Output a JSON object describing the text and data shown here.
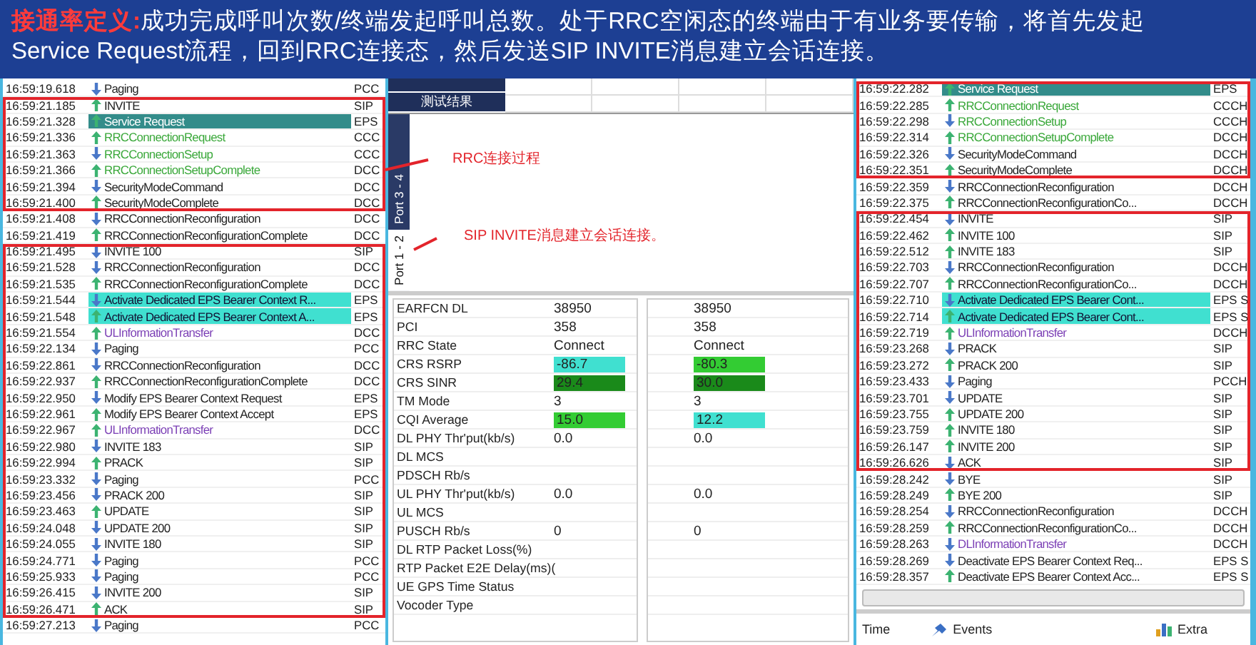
{
  "banner": {
    "label": "接通率定义:",
    "lines": [
      "成功完成呼叫次数/终端发起呼叫总数。处于RRC空闲态的终端由于有业务要传输，将首先发起",
      "Service Request流程，回到RRC连接态，然后发送SIP INVITE消息建立会话连接。"
    ]
  },
  "left_log": {
    "groups": [
      {
        "boxed": false,
        "rows": [
          {
            "time": "16:59:19.618",
            "uplink": false,
            "message": "Paging",
            "channel": "PCC",
            "kind": "plain"
          }
        ]
      },
      {
        "boxed": true,
        "rows": [
          {
            "time": "16:59:21.185",
            "uplink": true,
            "message": "INVITE",
            "channel": "SIP",
            "kind": "plain"
          },
          {
            "time": "16:59:21.328",
            "uplink": true,
            "message": "Service Request",
            "channel": "EPS",
            "kind": "teal"
          },
          {
            "time": "16:59:21.336",
            "uplink": true,
            "message": "RRCConnectionRequest",
            "channel": "CCC",
            "kind": "green"
          },
          {
            "time": "16:59:21.363",
            "uplink": false,
            "message": "RRCConnectionSetup",
            "channel": "CCC",
            "kind": "green"
          },
          {
            "time": "16:59:21.366",
            "uplink": true,
            "message": "RRCConnectionSetupComplete",
            "channel": "DCC",
            "kind": "green"
          },
          {
            "time": "16:59:21.394",
            "uplink": false,
            "message": "SecurityModeCommand",
            "channel": "DCC",
            "kind": "plain"
          },
          {
            "time": "16:59:21.400",
            "uplink": true,
            "message": "SecurityModeComplete",
            "channel": "DCC",
            "kind": "plain"
          }
        ]
      },
      {
        "boxed": false,
        "rows": [
          {
            "time": "16:59:21.408",
            "uplink": false,
            "message": "RRCConnectionReconfiguration",
            "channel": "DCC",
            "kind": "plain"
          },
          {
            "time": "16:59:21.419",
            "uplink": true,
            "message": "RRCConnectionReconfigurationComplete",
            "channel": "DCC",
            "kind": "plain"
          }
        ]
      },
      {
        "boxed": true,
        "rows": [
          {
            "time": "16:59:21.495",
            "uplink": false,
            "message": "INVITE 100",
            "channel": "SIP",
            "kind": "plain"
          },
          {
            "time": "16:59:21.528",
            "uplink": false,
            "message": "RRCConnectionReconfiguration",
            "channel": "DCC",
            "kind": "plain"
          },
          {
            "time": "16:59:21.535",
            "uplink": true,
            "message": "RRCConnectionReconfigurationComplete",
            "channel": "DCC",
            "kind": "plain"
          },
          {
            "time": "16:59:21.544",
            "uplink": false,
            "message": "Activate Dedicated EPS Bearer Context R...",
            "channel": "EPS",
            "kind": "cyan"
          },
          {
            "time": "16:59:21.548",
            "uplink": true,
            "message": "Activate Dedicated EPS Bearer Context A...",
            "channel": "EPS",
            "kind": "cyan"
          },
          {
            "time": "16:59:21.554",
            "uplink": true,
            "message": "ULInformationTransfer",
            "channel": "DCC",
            "kind": "purple"
          },
          {
            "time": "16:59:22.134",
            "uplink": false,
            "message": "Paging",
            "channel": "PCC",
            "kind": "plain"
          },
          {
            "time": "16:59:22.861",
            "uplink": false,
            "message": "RRCConnectionReconfiguration",
            "channel": "DCC",
            "kind": "plain"
          },
          {
            "time": "16:59:22.937",
            "uplink": true,
            "message": "RRCConnectionReconfigurationComplete",
            "channel": "DCC",
            "kind": "plain"
          },
          {
            "time": "16:59:22.950",
            "uplink": false,
            "message": "Modify EPS Bearer Context Request",
            "channel": "EPS",
            "kind": "plain"
          },
          {
            "time": "16:59:22.961",
            "uplink": true,
            "message": "Modify EPS Bearer Context Accept",
            "channel": "EPS",
            "kind": "plain"
          },
          {
            "time": "16:59:22.967",
            "uplink": true,
            "message": "ULInformationTransfer",
            "channel": "DCC",
            "kind": "purple"
          },
          {
            "time": "16:59:22.980",
            "uplink": false,
            "message": "INVITE 183",
            "channel": "SIP",
            "kind": "plain"
          },
          {
            "time": "16:59:22.994",
            "uplink": true,
            "message": "PRACK",
            "channel": "SIP",
            "kind": "plain"
          },
          {
            "time": "16:59:23.332",
            "uplink": false,
            "message": "Paging",
            "channel": "PCC",
            "kind": "plain"
          },
          {
            "time": "16:59:23.456",
            "uplink": false,
            "message": "PRACK 200",
            "channel": "SIP",
            "kind": "plain"
          },
          {
            "time": "16:59:23.463",
            "uplink": true,
            "message": "UPDATE",
            "channel": "SIP",
            "kind": "plain"
          },
          {
            "time": "16:59:24.048",
            "uplink": false,
            "message": "UPDATE 200",
            "channel": "SIP",
            "kind": "plain"
          },
          {
            "time": "16:59:24.055",
            "uplink": false,
            "message": "INVITE 180",
            "channel": "SIP",
            "kind": "plain"
          },
          {
            "time": "16:59:24.771",
            "uplink": false,
            "message": "Paging",
            "channel": "PCC",
            "kind": "plain"
          },
          {
            "time": "16:59:25.933",
            "uplink": false,
            "message": "Paging",
            "channel": "PCC",
            "kind": "plain"
          },
          {
            "time": "16:59:26.415",
            "uplink": false,
            "message": "INVITE 200",
            "channel": "SIP",
            "kind": "plain"
          },
          {
            "time": "16:59:26.471",
            "uplink": true,
            "message": "ACK",
            "channel": "SIP",
            "kind": "plain"
          }
        ]
      },
      {
        "boxed": false,
        "rows": [
          {
            "time": "16:59:27.213",
            "uplink": false,
            "message": "Paging",
            "channel": "PCC",
            "kind": "plain"
          }
        ]
      }
    ]
  },
  "middle": {
    "header": [
      "测试结果"
    ],
    "annotations": [
      "RRC连接过程",
      "SIP INVITE消息建立会话连接。"
    ],
    "port_tabs": [
      {
        "label": "Port 3 - 4",
        "selected": false
      },
      {
        "label": "Port 1 - 2",
        "selected": true
      }
    ],
    "metrics": [
      {
        "label": "EARFCN DL",
        "values": [
          {
            "text": "38950"
          },
          {
            "text": "38950"
          }
        ]
      },
      {
        "label": "PCI",
        "values": [
          {
            "text": "358"
          },
          {
            "text": "358"
          }
        ]
      },
      {
        "label": "RRC State",
        "values": [
          {
            "text": "Connect"
          },
          {
            "text": "Connect"
          }
        ]
      },
      {
        "label": "CRS RSRP",
        "values": [
          {
            "text": "-86.7",
            "color": "#40e0d0"
          },
          {
            "text": "-80.3",
            "color": "#33cc33"
          }
        ]
      },
      {
        "label": "CRS SINR",
        "values": [
          {
            "text": "29.4",
            "color": "#1a8a1a"
          },
          {
            "text": "30.0",
            "color": "#1a8a1a"
          }
        ]
      },
      {
        "label": "TM Mode",
        "values": [
          {
            "text": "3"
          },
          {
            "text": "3"
          }
        ]
      },
      {
        "label": "CQI Average",
        "values": [
          {
            "text": "15.0",
            "color": "#33cc33"
          },
          {
            "text": "12.2",
            "color": "#40e0d0"
          }
        ]
      },
      {
        "label": "DL PHY Thr'put(kb/s)",
        "values": [
          {
            "text": "0.0"
          },
          {
            "text": "0.0"
          }
        ]
      },
      {
        "label": "DL MCS"
      },
      {
        "label": "PDSCH Rb/s"
      },
      {
        "label": "UL PHY Thr'put(kb/s)",
        "values": [
          {
            "text": "0.0"
          },
          {
            "text": "0.0"
          }
        ]
      },
      {
        "label": "UL MCS"
      },
      {
        "label": "PUSCH Rb/s",
        "values": [
          {
            "text": "0"
          },
          {
            "text": "0"
          }
        ]
      },
      {
        "label": "DL RTP Packet Loss(%)"
      },
      {
        "label": "RTP Packet E2E Delay(ms)("
      },
      {
        "label": "UE GPS Time Status"
      },
      {
        "label": "Vocoder Type"
      }
    ]
  },
  "right_log": {
    "groups": [
      {
        "boxed": true,
        "rows": [
          {
            "time": "16:59:22.282",
            "uplink": true,
            "message": "Service Request",
            "channel": "EPS",
            "kind": "teal"
          },
          {
            "time": "16:59:22.285",
            "uplink": true,
            "message": "RRCConnectionRequest",
            "channel": "CCCH",
            "kind": "green"
          },
          {
            "time": "16:59:22.298",
            "uplink": false,
            "message": "RRCConnectionSetup",
            "channel": "CCCH",
            "kind": "green"
          },
          {
            "time": "16:59:22.314",
            "uplink": true,
            "message": "RRCConnectionSetupComplete",
            "channel": "DCCH",
            "kind": "green"
          },
          {
            "time": "16:59:22.326",
            "uplink": false,
            "message": "SecurityModeCommand",
            "channel": "DCCH",
            "kind": "plain"
          },
          {
            "time": "16:59:22.351",
            "uplink": true,
            "message": "SecurityModeComplete",
            "channel": "DCCH",
            "kind": "plain"
          }
        ]
      },
      {
        "boxed": false,
        "rows": [
          {
            "time": "16:59:22.359",
            "uplink": false,
            "message": "RRCConnectionReconfiguration",
            "channel": "DCCH",
            "kind": "plain"
          },
          {
            "time": "16:59:22.375",
            "uplink": true,
            "message": "RRCConnectionReconfigurationCo...",
            "channel": "DCCH",
            "kind": "plain"
          }
        ]
      },
      {
        "boxed": true,
        "rows": [
          {
            "time": "16:59:22.454",
            "uplink": false,
            "message": "INVITE",
            "channel": "SIP",
            "kind": "plain"
          },
          {
            "time": "16:59:22.462",
            "uplink": true,
            "message": "INVITE 100",
            "channel": "SIP",
            "kind": "plain"
          },
          {
            "time": "16:59:22.512",
            "uplink": true,
            "message": "INVITE 183",
            "channel": "SIP",
            "kind": "plain"
          },
          {
            "time": "16:59:22.703",
            "uplink": false,
            "message": "RRCConnectionReconfiguration",
            "channel": "DCCH",
            "kind": "plain"
          },
          {
            "time": "16:59:22.707",
            "uplink": true,
            "message": "RRCConnectionReconfigurationCo...",
            "channel": "DCCH",
            "kind": "plain"
          },
          {
            "time": "16:59:22.710",
            "uplink": false,
            "message": "Activate Dedicated EPS Bearer Cont...",
            "channel": "EPS S",
            "kind": "cyan"
          },
          {
            "time": "16:59:22.714",
            "uplink": true,
            "message": "Activate Dedicated EPS Bearer Cont...",
            "channel": "EPS S",
            "kind": "cyan"
          },
          {
            "time": "16:59:22.719",
            "uplink": true,
            "message": "ULInformationTransfer",
            "channel": "DCCH",
            "kind": "purple"
          },
          {
            "time": "16:59:23.268",
            "uplink": false,
            "message": "PRACK",
            "channel": "SIP",
            "kind": "plain"
          },
          {
            "time": "16:59:23.272",
            "uplink": true,
            "message": "PRACK 200",
            "channel": "SIP",
            "kind": "plain"
          },
          {
            "time": "16:59:23.433",
            "uplink": false,
            "message": "Paging",
            "channel": "PCCH",
            "kind": "plain"
          },
          {
            "time": "16:59:23.701",
            "uplink": false,
            "message": "UPDATE",
            "channel": "SIP",
            "kind": "plain"
          },
          {
            "time": "16:59:23.755",
            "uplink": true,
            "message": "UPDATE 200",
            "channel": "SIP",
            "kind": "plain"
          },
          {
            "time": "16:59:23.759",
            "uplink": true,
            "message": "INVITE 180",
            "channel": "SIP",
            "kind": "plain"
          },
          {
            "time": "16:59:26.147",
            "uplink": true,
            "message": "INVITE 200",
            "channel": "SIP",
            "kind": "plain"
          },
          {
            "time": "16:59:26.626",
            "uplink": false,
            "message": "ACK",
            "channel": "SIP",
            "kind": "plain"
          }
        ]
      },
      {
        "boxed": false,
        "rows": [
          {
            "time": "16:59:28.242",
            "uplink": false,
            "message": "BYE",
            "channel": "SIP",
            "kind": "plain"
          },
          {
            "time": "16:59:28.249",
            "uplink": true,
            "message": "BYE 200",
            "channel": "SIP",
            "kind": "plain"
          },
          {
            "time": "16:59:28.254",
            "uplink": false,
            "message": "RRCConnectionReconfiguration",
            "channel": "DCCH",
            "kind": "plain"
          },
          {
            "time": "16:59:28.259",
            "uplink": true,
            "message": "RRCConnectionReconfigurationCo...",
            "channel": "DCCH",
            "kind": "plain"
          },
          {
            "time": "16:59:28.263",
            "uplink": false,
            "message": "DLInformationTransfer",
            "channel": "DCCH",
            "kind": "purple"
          },
          {
            "time": "16:59:28.269",
            "uplink": false,
            "message": "Deactivate EPS Bearer Context Req...",
            "channel": "EPS S",
            "kind": "plain"
          },
          {
            "time": "16:59:28.357",
            "uplink": true,
            "message": "Deactivate EPS Bearer Context Acc...",
            "channel": "EPS S",
            "kind": "plain"
          }
        ]
      }
    ],
    "columns": [
      {
        "label": "Time"
      },
      {
        "label": "Events"
      },
      {
        "label": "Extra"
      }
    ]
  }
}
